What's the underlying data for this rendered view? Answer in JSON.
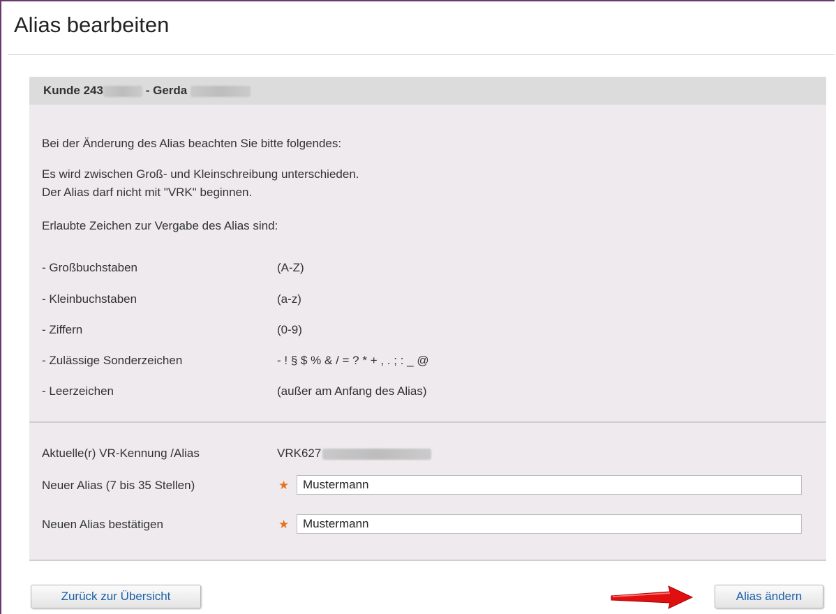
{
  "page": {
    "title": "Alias bearbeiten"
  },
  "customer": {
    "prefix": "Kunde 243",
    "separator": " - Gerda "
  },
  "info": {
    "intro": "Bei der Änderung des Alias beachten Sie bitte folgendes:",
    "rule1": "Es wird zwischen Groß- und Kleinschreibung unterschieden.",
    "rule2": "Der Alias darf nicht mit \"VRK\" beginnen.",
    "allowed_heading": "Erlaubte Zeichen zur Vergabe des Alias sind:",
    "chars": [
      {
        "label": "- Großbuchstaben",
        "value": "(A-Z)"
      },
      {
        "label": "- Kleinbuchstaben",
        "value": "(a-z)"
      },
      {
        "label": "- Ziffern",
        "value": "(0-9)"
      },
      {
        "label": "- Zulässige Sonderzeichen",
        "value": "- ! § $ % & / = ? * + , . ; : _ @"
      },
      {
        "label": "- Leerzeichen",
        "value": "(außer am Anfang des Alias)"
      }
    ]
  },
  "form": {
    "current_label": "Aktuelle(r) VR-Kennung /Alias",
    "current_value": "VRK627",
    "new_label": "Neuer Alias (7 bis 35 Stellen)",
    "new_value": "Mustermann",
    "confirm_label": "Neuen Alias bestätigen",
    "confirm_value": "Mustermann",
    "required_mark": "★"
  },
  "buttons": {
    "back": "Zurück zur Übersicht",
    "submit": "Alias ändern"
  },
  "colors": {
    "accent_star": "#e8731e",
    "link_text": "#1a5fa8",
    "arrow": "#e01010"
  }
}
